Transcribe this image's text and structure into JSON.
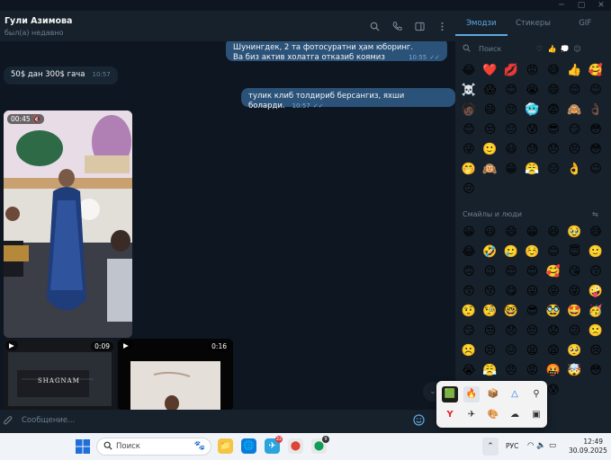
{
  "window": {
    "controls": [
      "─",
      "▢",
      "✕"
    ]
  },
  "chat": {
    "contact_name": "Гули Азимова",
    "status": "был(а) недавно",
    "header_icons": [
      "search-icon",
      "phone-icon",
      "sidebar-toggle-icon",
      "more-icon"
    ]
  },
  "messages": [
    {
      "dir": "out",
      "lines": [
        "Шунингдек, 2 та фотосуратни ҳам юборинг.",
        "Ва биз актив холатга отказиб коямиз"
      ],
      "time": "10:55"
    },
    {
      "dir": "in",
      "text": "50$ дан 300$ гача",
      "time": "10:57"
    },
    {
      "dir": "out",
      "text": "тулик клиб толдириб берсангиз, яхши боларди.",
      "time": "10:57"
    }
  ],
  "videos": [
    {
      "duration": "00:45",
      "muted": true
    },
    {
      "duration": "0:09"
    },
    {
      "duration": "0:16"
    }
  ],
  "video_caption": "SHAGNAM",
  "composer": {
    "placeholder": "Сообщение..."
  },
  "emoji_panel": {
    "tabs": [
      "Эмодзи",
      "Стикеры",
      "GIF"
    ],
    "active_tab": 0,
    "search_placeholder": "Поиск",
    "categories": [
      "♡",
      "👍",
      "💭",
      "☺"
    ],
    "recent": [
      "😂",
      "❤️",
      "💋",
      "😡",
      "😅",
      "👍",
      "🥰",
      "☠️",
      "😱",
      "😊",
      "😭",
      "😄",
      "😌",
      "😉",
      "🧑🏿",
      "😄",
      "😔",
      "🥶",
      "😨",
      "🙈",
      "👌🏿",
      "😊",
      "😒",
      "😐",
      "😰",
      "😎",
      "😏",
      "😳",
      "😜",
      "🙂",
      "😃",
      "😓",
      "😞",
      "😣",
      "😳",
      "🤭",
      "🙉",
      "😁",
      "😤",
      "😑",
      "👌",
      "😉",
      "😕"
    ],
    "section_title": "Смайлы и люди",
    "smileys": [
      "😀",
      "😃",
      "😄",
      "😁",
      "😆",
      "🥹",
      "😅",
      "😂",
      "🤣",
      "🥲",
      "☺️",
      "😊",
      "😇",
      "🙂",
      "🙃",
      "😉",
      "😌",
      "😍",
      "🥰",
      "😘",
      "😗",
      "😙",
      "😚",
      "😋",
      "😛",
      "😝",
      "😜",
      "🤪",
      "🤨",
      "🧐",
      "🤓",
      "😎",
      "🥸",
      "🤩",
      "🥳",
      "😏",
      "😒",
      "😞",
      "😔",
      "😟",
      "😕",
      "🙁",
      "☹️",
      "😣",
      "😖",
      "😫",
      "😩",
      "🥺",
      "😢",
      "😭",
      "😤",
      "😠",
      "😡",
      "🤬",
      "🤯",
      "😳",
      "🥵",
      "🥶",
      "😱",
      "😨",
      "😰"
    ]
  },
  "tray_popup": {
    "row1": [
      "🟩",
      "🔥",
      "📦",
      "△",
      "⚲"
    ],
    "row2": [
      "Y",
      "✈",
      "🎨",
      "☁",
      "▣"
    ]
  },
  "taskbar": {
    "search_placeholder": "Поиск",
    "apps": [
      "📁",
      "🌐",
      "✈",
      "⬤",
      "⬤"
    ],
    "badges": [
      "",
      "",
      "22",
      "",
      "9"
    ],
    "lang": "РУС",
    "time": "12:49",
    "date": "30.09.2025"
  }
}
